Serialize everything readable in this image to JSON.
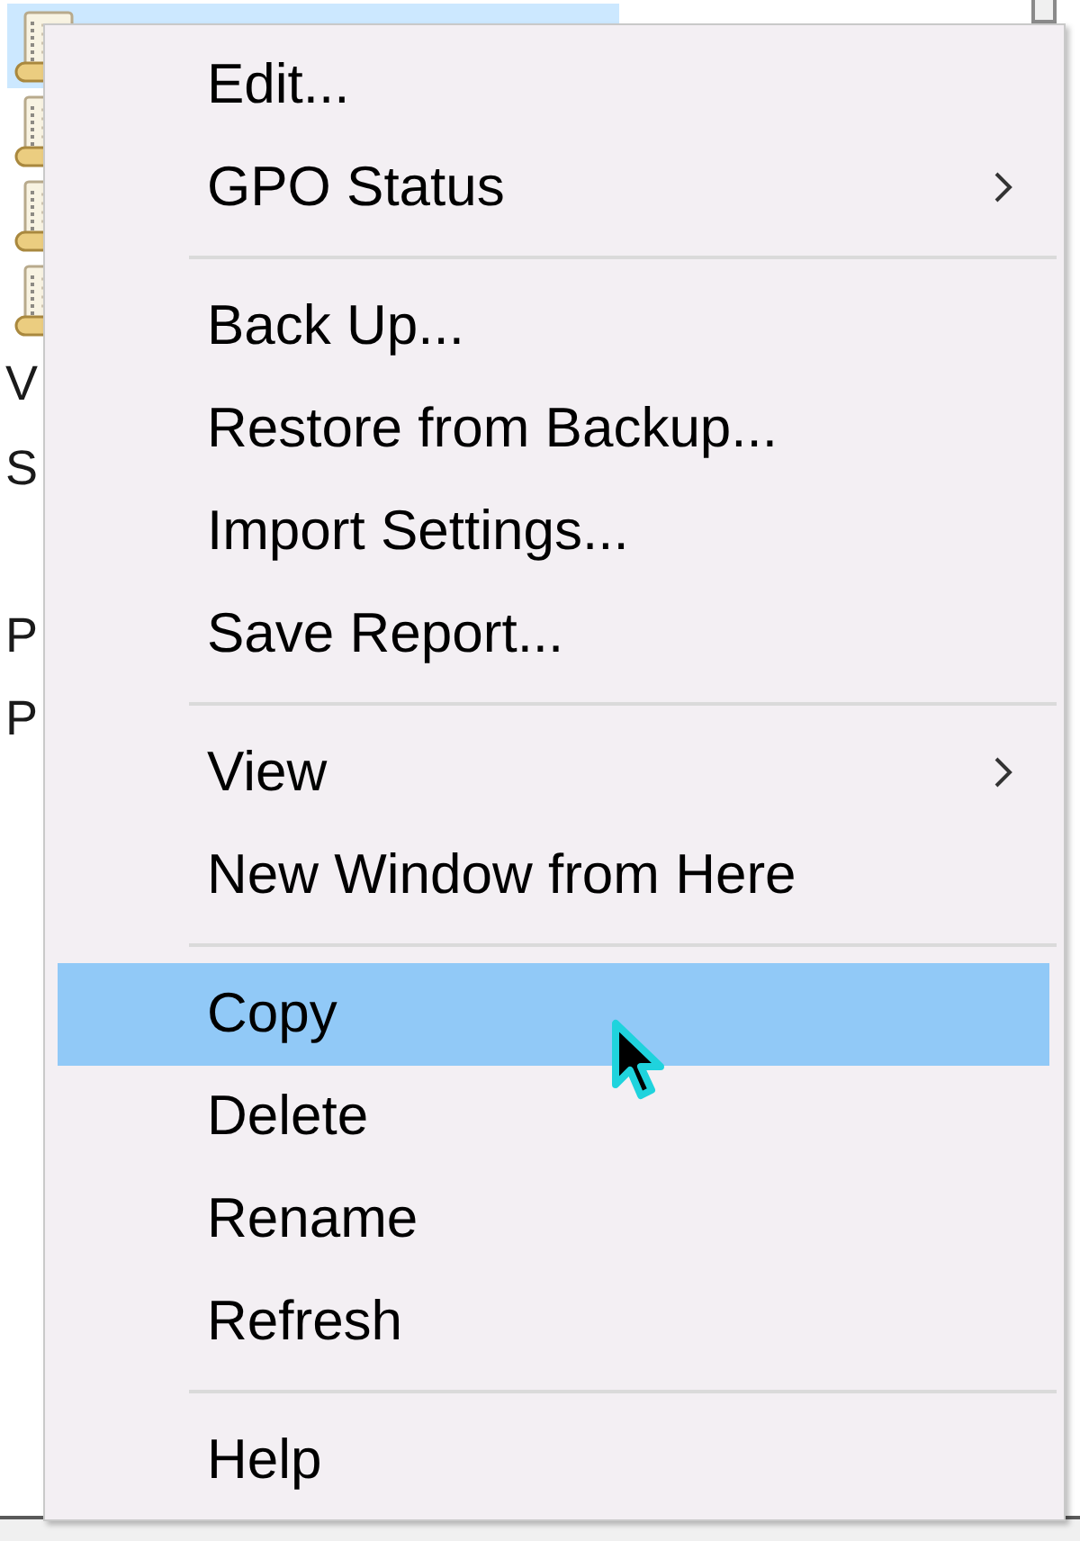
{
  "tree": {
    "items": [
      {
        "kind": "gpo",
        "selected": true
      },
      {
        "kind": "gpo",
        "selected": false
      },
      {
        "kind": "gpo",
        "selected": false
      },
      {
        "kind": "gpo",
        "selected": false
      },
      {
        "kind": "text",
        "label": "V",
        "selected": false
      },
      {
        "kind": "text",
        "label": "S",
        "selected": false
      }
    ]
  },
  "list": {
    "items": [
      {
        "label": "P",
        "selected": false
      },
      {
        "label": "P",
        "selected": false
      }
    ]
  },
  "context_menu": {
    "items": [
      {
        "kind": "command",
        "label": "Edit...",
        "submenu": false,
        "selected": false
      },
      {
        "kind": "command",
        "label": "GPO Status",
        "submenu": true,
        "selected": false
      },
      {
        "kind": "separator"
      },
      {
        "kind": "command",
        "label": "Back Up...",
        "submenu": false,
        "selected": false
      },
      {
        "kind": "command",
        "label": "Restore from Backup...",
        "submenu": false,
        "selected": false
      },
      {
        "kind": "command",
        "label": "Import Settings...",
        "submenu": false,
        "selected": false
      },
      {
        "kind": "command",
        "label": "Save Report...",
        "submenu": false,
        "selected": false
      },
      {
        "kind": "separator"
      },
      {
        "kind": "command",
        "label": "View",
        "submenu": true,
        "selected": false
      },
      {
        "kind": "command",
        "label": "New Window from Here",
        "submenu": false,
        "selected": false
      },
      {
        "kind": "separator"
      },
      {
        "kind": "command",
        "label": "Copy",
        "submenu": false,
        "selected": true
      },
      {
        "kind": "command",
        "label": "Delete",
        "submenu": false,
        "selected": false
      },
      {
        "kind": "command",
        "label": "Rename",
        "submenu": false,
        "selected": false
      },
      {
        "kind": "command",
        "label": "Refresh",
        "submenu": false,
        "selected": false
      },
      {
        "kind": "separator"
      },
      {
        "kind": "command",
        "label": "Help",
        "submenu": false,
        "selected": false
      }
    ]
  }
}
